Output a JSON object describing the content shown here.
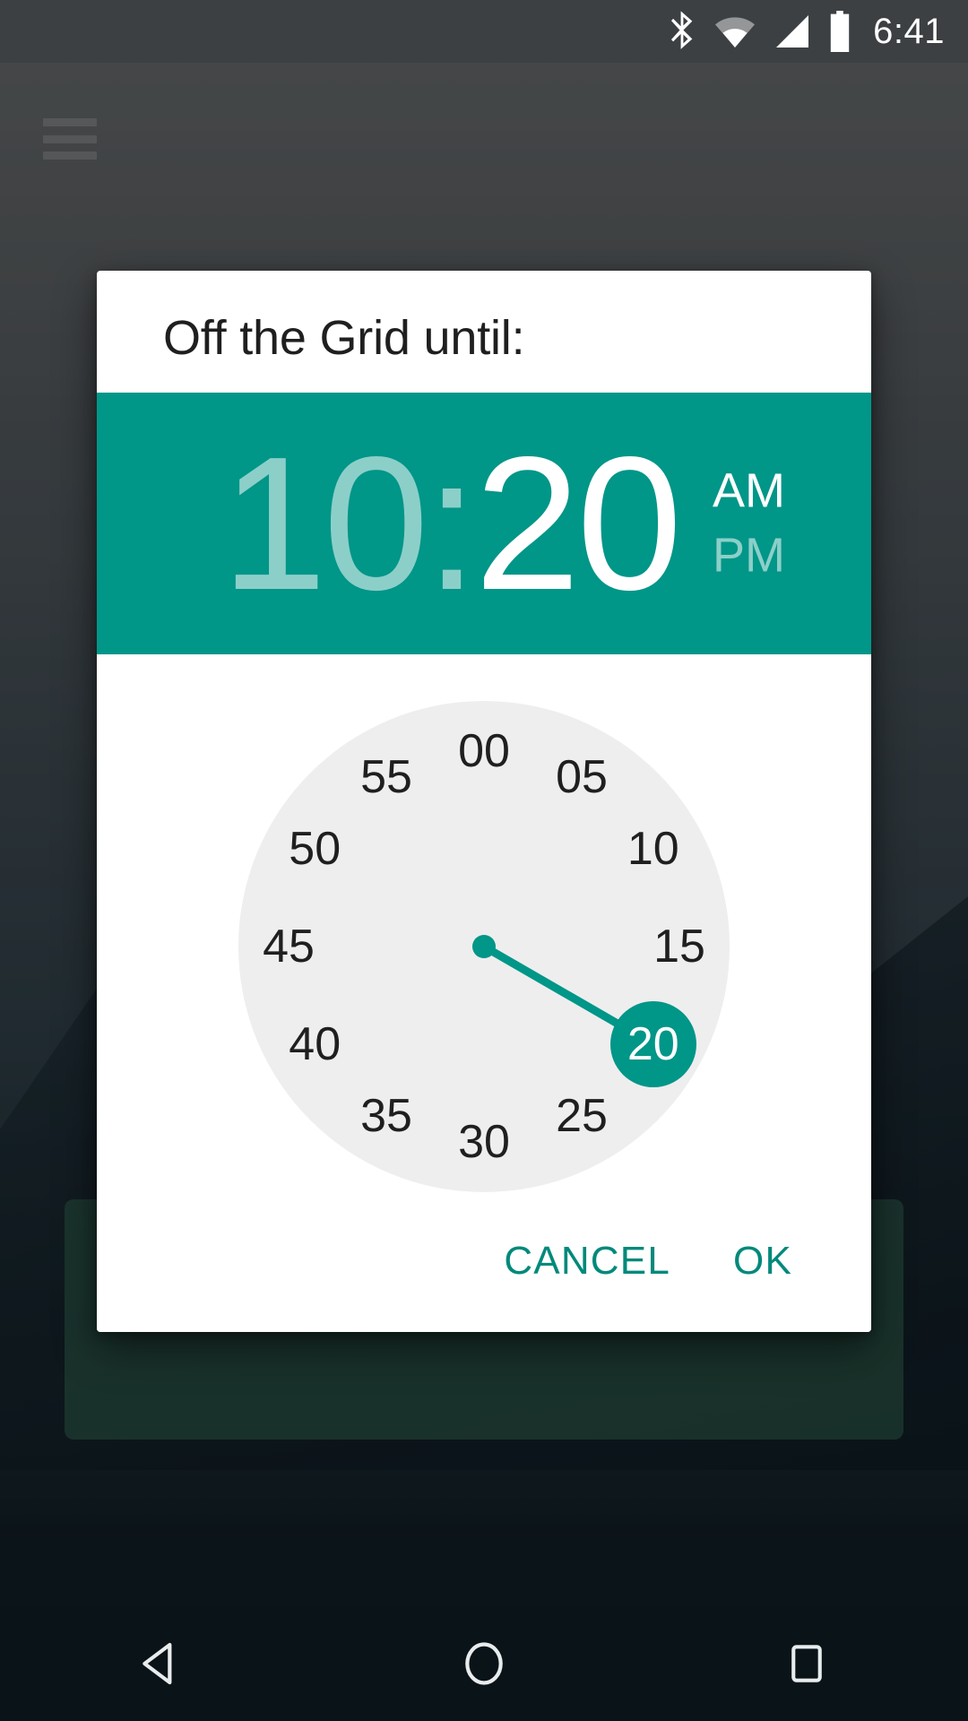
{
  "status_bar": {
    "time": "6:41",
    "icons": [
      "bluetooth-icon",
      "wifi-icon",
      "cellular-signal-icon",
      "battery-icon"
    ]
  },
  "background_app": {
    "menu_icon": "hamburger-menu-icon",
    "card_color": "#2f5c4b"
  },
  "dialog": {
    "title": "Off the Grid until:",
    "time_header": {
      "hour": "10",
      "separator": ":",
      "minute": "20",
      "hour_active": false,
      "minute_active": true,
      "am_label": "AM",
      "pm_label": "PM",
      "meridiem_selected": "AM",
      "background_color": "#009688"
    },
    "clock": {
      "mode": "minutes",
      "selected_value": "20",
      "face_color": "#eeeeee",
      "accent_color": "#009688",
      "numbers": [
        "00",
        "05",
        "10",
        "15",
        "20",
        "25",
        "30",
        "35",
        "40",
        "45",
        "50",
        "55"
      ]
    },
    "actions": {
      "cancel_label": "CANCEL",
      "ok_label": "OK",
      "color": "#00897b"
    }
  },
  "nav_bar": {
    "back_icon": "back-triangle-icon",
    "home_icon": "home-circle-icon",
    "recents_icon": "recents-square-icon"
  }
}
